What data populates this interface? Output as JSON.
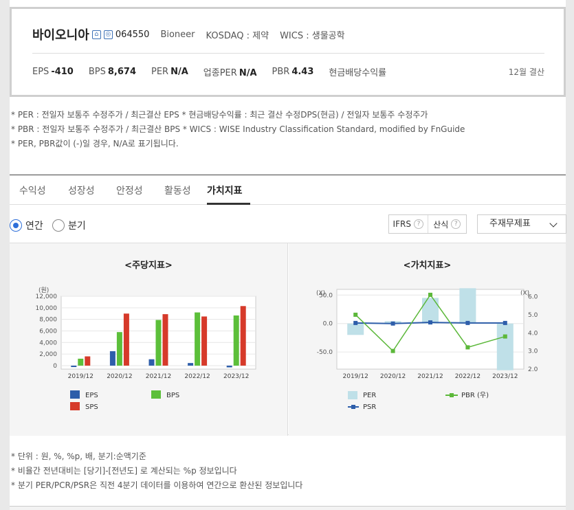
{
  "company": {
    "name": "바이오니아",
    "code": "064550",
    "english_name": "Bioneer",
    "market": "KOSDAQ : 제약",
    "wics": "WICS : 생물공학",
    "badge1_icon": "home-icon",
    "badge2_icon": "ir-icon"
  },
  "metrics": [
    {
      "label": "EPS",
      "value": "-410"
    },
    {
      "label": "BPS",
      "value": "8,674"
    },
    {
      "label": "PER",
      "value": "N/A"
    },
    {
      "label": "업종PER",
      "value": "N/A"
    },
    {
      "label": "PBR",
      "value": "4.43"
    },
    {
      "label": "현금배당수익률",
      "value": ""
    }
  ],
  "settlement": "12월 결산",
  "notes": [
    "* PER : 전일자 보통주 수정주가 / 최근결산 EPS * 현금배당수익률 : 최근 결산 수정DPS(현금) / 전일자 보통주 수정주가",
    "* PBR : 전일자 보통주 수정주가 / 최근결산 BPS * WICS : WISE Industry Classification Standard, modified by FnGuide",
    "* PER, PBR값이 (-)일 경우, N/A로 표기됩니다."
  ],
  "tabs": [
    "수익성",
    "성장성",
    "안정성",
    "활동성",
    "가치지표"
  ],
  "active_tab": "가치지표",
  "period": {
    "annual": "연간",
    "quarter": "분기",
    "selected": "연간"
  },
  "toggles": {
    "ifrs": "IFRS",
    "calc": "산식",
    "help": "?"
  },
  "select": {
    "value": "주재무제표"
  },
  "colors": {
    "eps": "#2e5eaa",
    "bps": "#5cbf3a",
    "sps": "#d63a2a",
    "per": "#bfe0e8",
    "pbr": "#5cb83a",
    "psr": "#2e5eaa",
    "accent": "#2e6fd9"
  },
  "chart_data": [
    {
      "type": "bar",
      "title": "<주당지표>",
      "unit": "(원)",
      "categories": [
        "2019/12",
        "2020/12",
        "2021/12",
        "2022/12",
        "2023/12"
      ],
      "series": [
        {
          "name": "EPS",
          "values": [
            -250,
            2500,
            1100,
            450,
            -300
          ]
        },
        {
          "name": "BPS",
          "values": [
            1200,
            5800,
            7900,
            9200,
            8674
          ]
        },
        {
          "name": "SPS",
          "values": [
            1600,
            9000,
            8900,
            8500,
            10300
          ]
        }
      ],
      "ylim": [
        -600,
        12000
      ],
      "yticks": [
        0,
        2000,
        4000,
        6000,
        8000,
        10000,
        12000
      ],
      "ytick_labels": [
        "0",
        "2,000",
        "4,000",
        "6,000",
        "8,000",
        "10,000",
        "12,000"
      ],
      "legend": "bottom"
    },
    {
      "type": "bar",
      "title": "<가치지표>",
      "y_left_unit": "(X)",
      "y_right_unit": "(X)",
      "categories": [
        "2019/12",
        "2020/12",
        "2021/12",
        "2022/12",
        "2023/12"
      ],
      "series": [
        {
          "name": "PER",
          "type": "bar",
          "axis": "left",
          "values": [
            -20,
            4,
            45,
            62,
            -82
          ]
        },
        {
          "name": "PBR (우)",
          "type": "line",
          "axis": "right",
          "values": [
            5.0,
            3.0,
            6.1,
            3.2,
            3.8
          ]
        },
        {
          "name": "PSR",
          "type": "line",
          "axis": "left",
          "values": [
            1,
            0,
            2,
            1,
            1
          ]
        }
      ],
      "ylim_left": [
        -80,
        60
      ],
      "yticks_left": [
        50,
        0,
        -50
      ],
      "ytick_labels_left": [
        "50.0",
        "0.0",
        "-50.0"
      ],
      "ylim_right": [
        2.0,
        6.4
      ],
      "yticks_right": [
        2,
        3,
        4,
        5,
        6
      ],
      "ytick_labels_right": [
        "2.0",
        "3.0",
        "4.0",
        "5.0",
        "6.0"
      ],
      "legend": "bottom"
    }
  ],
  "footnotes": [
    "* 단위 : 원, %, %p, 배, 분기:순액기준",
    "* 비율간 전년대비는 [당기]-[전년도] 로 계산되는 %p 정보입니다",
    "* 분기 PER/PCR/PSR은 직전 4분기 데이터를 이용하여 연간으로 환산된 정보입니다"
  ]
}
